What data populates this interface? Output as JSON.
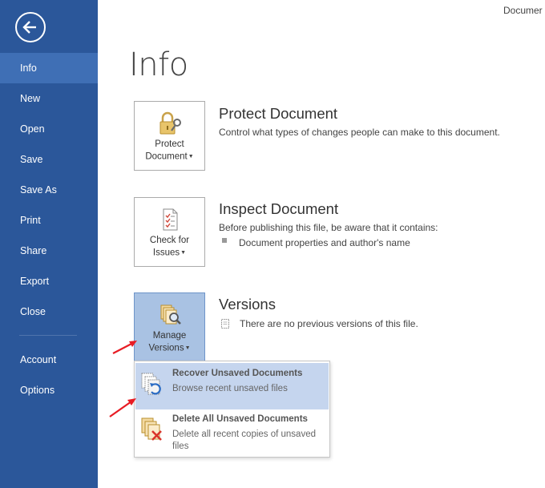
{
  "window": {
    "title_fragment": "Documer"
  },
  "sidebar": {
    "items": [
      {
        "label": "Info"
      },
      {
        "label": "New"
      },
      {
        "label": "Open"
      },
      {
        "label": "Save"
      },
      {
        "label": "Save As"
      },
      {
        "label": "Print"
      },
      {
        "label": "Share"
      },
      {
        "label": "Export"
      },
      {
        "label": "Close"
      },
      {
        "label": "Account"
      },
      {
        "label": "Options"
      }
    ]
  },
  "main": {
    "page_title": "Info",
    "protect": {
      "button_line1": "Protect",
      "button_line2": "Document",
      "title": "Protect Document",
      "description": "Control what types of changes people can make to this document."
    },
    "inspect": {
      "button_line1": "Check for",
      "button_line2": "Issues",
      "title": "Inspect Document",
      "description": "Before publishing this file, be aware that it contains:",
      "bullet": "Document properties and author's name"
    },
    "versions": {
      "button_line1": "Manage",
      "button_line2": "Versions",
      "title": "Versions",
      "description": "There are no previous versions of this file."
    }
  },
  "dropdown": {
    "items": [
      {
        "title": "Recover Unsaved Documents",
        "description": "Browse recent unsaved files"
      },
      {
        "title": "Delete All Unsaved Documents",
        "description": "Delete all recent copies of unsaved files"
      }
    ]
  },
  "colors": {
    "sidebar": "#2b579a",
    "sidebar_active": "#3f6fb5",
    "selected_button": "#a9c2e3",
    "menu_hover": "#c5d5ee",
    "annotation_arrow": "#e81c24"
  }
}
